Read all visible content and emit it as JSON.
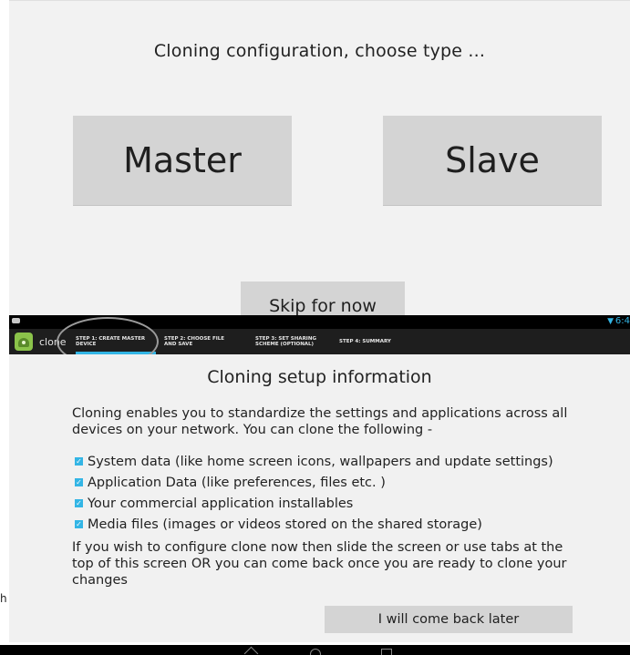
{
  "top_screen": {
    "title": "Cloning configuration, choose type ...",
    "master_label": "Master",
    "slave_label": "Slave",
    "skip_label": "Skip for now"
  },
  "status_bar": {
    "clock": "6:4"
  },
  "action_bar": {
    "app_name": "clone",
    "tabs": [
      {
        "label": "STEP 1: CREATE MASTER DEVICE"
      },
      {
        "label": "STEP 2: CHOOSE FILE AND SAVE"
      },
      {
        "label": "STEP 3: SET SHARING SCHEME (OPTIONAL)"
      },
      {
        "label": "STEP 4: SUMMARY"
      }
    ],
    "selected_tab_index": 0
  },
  "setup": {
    "title": "Cloning setup information",
    "intro": "Cloning enables you to standardize the settings and applications across all devices on your network. You can clone the following -",
    "features": [
      {
        "label": "System data (like home screen icons, wallpapers and update settings)",
        "checked": true
      },
      {
        "label": "Application Data (like preferences, files etc. )",
        "checked": true
      },
      {
        "label": "Your commercial application installables",
        "checked": true
      },
      {
        "label": "Media files (images or videos stored on the shared storage)",
        "checked": true
      }
    ],
    "outro": "If you wish to configure clone now then slide the screen or use tabs at the top of this screen OR you can come back once you are ready to clone your changes",
    "come_back_label": "I will come back later"
  },
  "stray_text": "h",
  "colors": {
    "accent": "#33b5e5",
    "button_bg": "#d4d4d4",
    "screen_bg": "#f2f2f2",
    "action_bar_bg": "#1e1e1e"
  },
  "icons": {
    "app": "android-clone-icon",
    "wifi": "wifi-icon",
    "check": "checkbox-checked-icon"
  }
}
